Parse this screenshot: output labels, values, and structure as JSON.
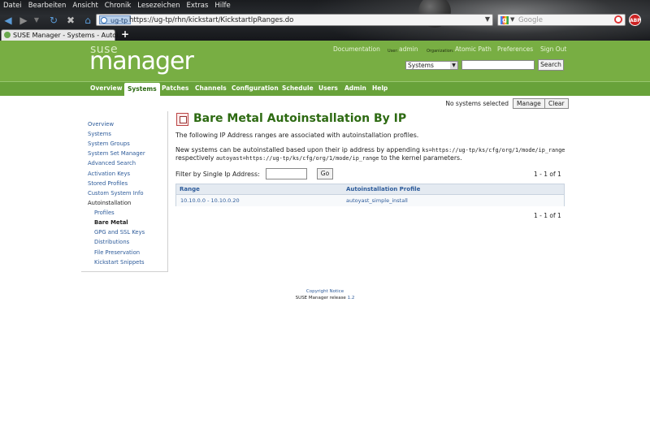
{
  "browser": {
    "menu": [
      "Datei",
      "Bearbeiten",
      "Ansicht",
      "Chronik",
      "Lesezeichen",
      "Extras",
      "Hilfe"
    ],
    "site_label": "ug-tp",
    "url": "https://ug-tp/rhn/kickstart/KickstartIpRanges.do",
    "search_placeholder": "Google",
    "adblock_label": "ABP",
    "tab_title": "SUSE Manager - Systems - Autoi...",
    "new_tab": "+"
  },
  "header": {
    "logo_top": "suse",
    "logo_bottom": "manager",
    "links": {
      "documentation": "Documentation",
      "user_label": "User:",
      "user_value": "admin",
      "org_label": "Organization:",
      "org_value": "Atomic Path",
      "preferences": "Preferences",
      "sign_out": "Sign Out"
    },
    "search_scope": "Systems",
    "search_button": "Search"
  },
  "main_nav": [
    "Overview",
    "Systems",
    "Patches",
    "Channels",
    "Configuration",
    "Schedule",
    "Users",
    "Admin",
    "Help"
  ],
  "system_selection": {
    "status": "No systems selected",
    "manage": "Manage",
    "clear": "Clear"
  },
  "sidebar": {
    "items": [
      {
        "label": "Overview"
      },
      {
        "label": "Systems"
      },
      {
        "label": "System Groups"
      },
      {
        "label": "System Set Manager"
      },
      {
        "label": "Advanced Search"
      },
      {
        "label": "Activation Keys"
      },
      {
        "label": "Stored Profiles"
      },
      {
        "label": "Custom System Info"
      },
      {
        "label": "Autoinstallation"
      },
      {
        "label": "Profiles"
      },
      {
        "label": "Bare Metal"
      },
      {
        "label": "GPG and SSL Keys"
      },
      {
        "label": "Distributions"
      },
      {
        "label": "File Preservation"
      },
      {
        "label": "Kickstart Snippets"
      }
    ]
  },
  "content": {
    "title": "Bare Metal Autoinstallation By IP",
    "intro": "The following IP Address ranges are associated with autoinstallation profiles.",
    "para_1": "New systems can be autoinstalled based upon their ip address by appending",
    "code_1": "ks=https://ug-tp/ks/cfg/org/1/mode/ip_range",
    "para_2": "respectively",
    "code_2": "autoyast=https://ug-tp/ks/cfg/org/1/mode/ip_range",
    "para_3": "to the kernel parameters.",
    "filter_label": "Filter by Single Ip Address:",
    "go": "Go",
    "count": "1 - 1 of 1",
    "table": {
      "headers": [
        "Range",
        "Autoinstallation Profile"
      ],
      "rows": [
        [
          "10.10.0.0 - 10.10.0.20",
          "autoyast_simple_install"
        ]
      ]
    }
  },
  "footer": {
    "copyright": "Copyright Notice",
    "release_prefix": "SUSE Manager release",
    "release_version": "1.2"
  }
}
